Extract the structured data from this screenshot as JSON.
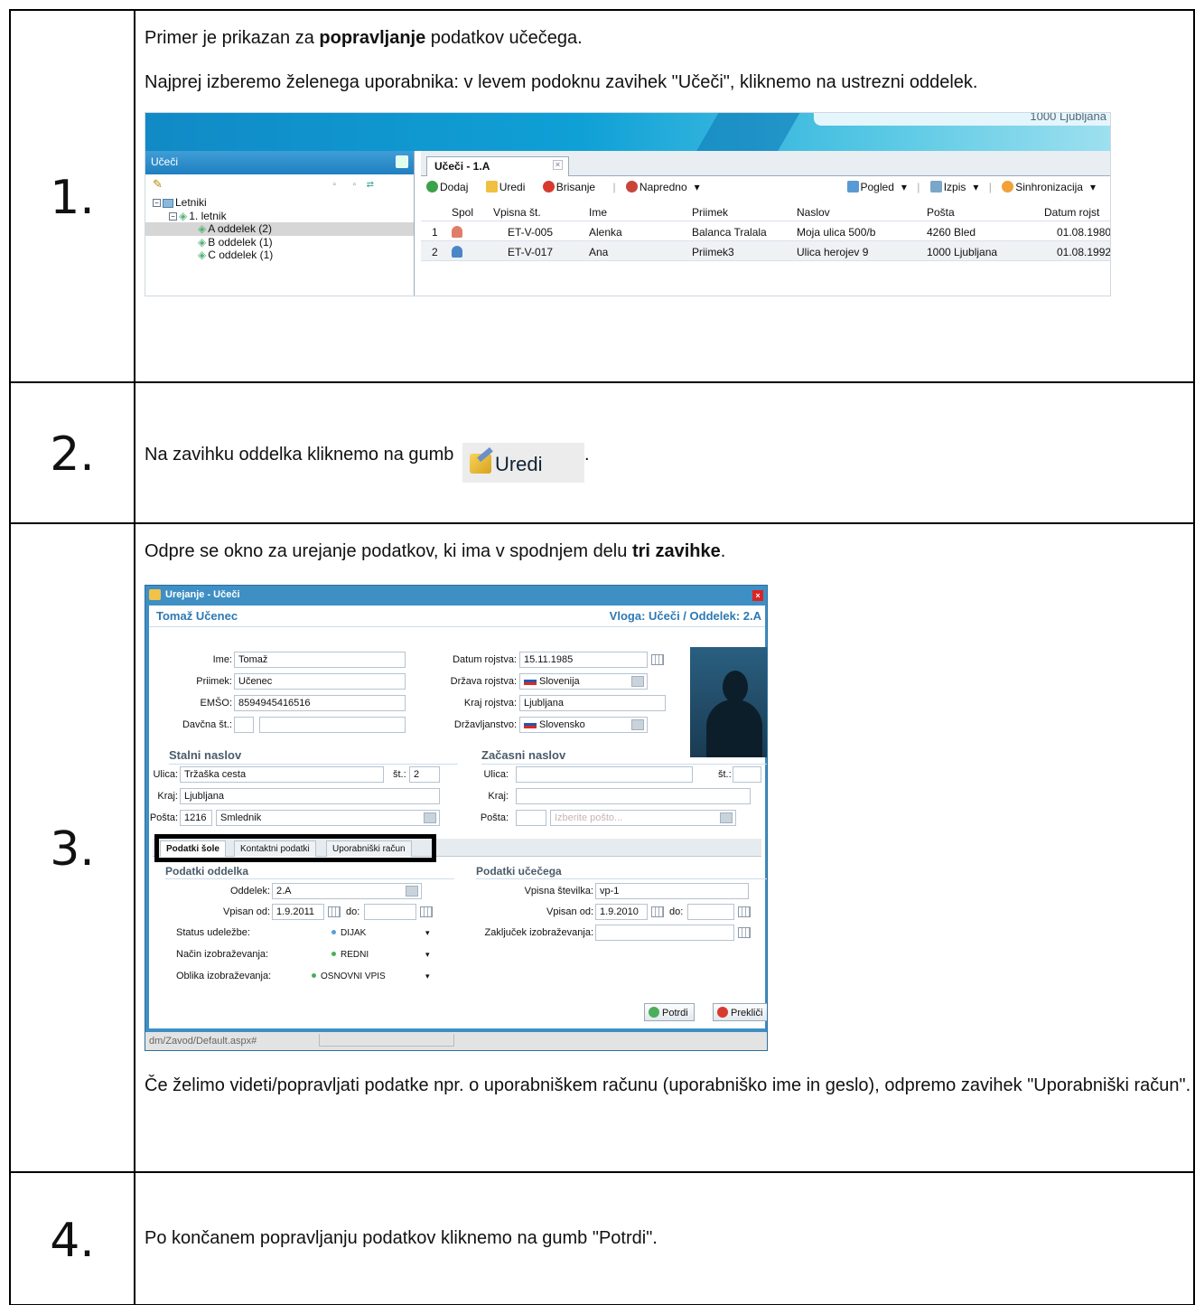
{
  "steps": [
    {
      "number": "1.",
      "text_pre": "Primer je prikazan za ",
      "text_bold": "popravljanje",
      "text_post": " podatkov učečega.",
      "text2": "Najprej izberemo želenega uporabnika: v levem podoknu zavihek \"Učeči\", kliknemo na ustrezni oddelek."
    },
    {
      "number": "2.",
      "text": "Na zavihku oddelka kliknemo na gumb ",
      "button_label": "Uredi",
      "text_end": "."
    },
    {
      "number": "3.",
      "text_pre": "Odpre se okno za urejanje podatkov, ki ima v spodnjem delu ",
      "text_bold": "tri zavihke",
      "text_post": ".",
      "text2": "Če želimo videti/popravljati podatke npr. o uporabniškem računu (uporabniško ime in geslo), odpremo zavihek \"Uporabniški račun\"."
    },
    {
      "number": "4.",
      "text": "Po končanem popravljanju podatkov kliknemo na gumb \"Potrdi\"."
    }
  ],
  "shot1": {
    "banner_address": "1000 Ljubljana",
    "left_title": "Učeči",
    "tree": [
      {
        "label": "Letniki"
      },
      {
        "label": "1. letnik"
      },
      {
        "label": "A oddelek (2)"
      },
      {
        "label": "B oddelek (1)"
      },
      {
        "label": "C oddelek (1)"
      }
    ],
    "tab_title": "Učeči - 1.A",
    "toolbar": {
      "dodaj": "Dodaj",
      "uredi": "Uredi",
      "brisanje": "Brisanje",
      "napredno": "Napredno",
      "pogled": "Pogled",
      "izpis": "Izpis",
      "sinhronizacija": "Sinhronizacija"
    },
    "columns": [
      "Spol",
      "Vpisna št.",
      "Ime",
      "Priimek",
      "Naslov",
      "Pošta",
      "Datum rojst"
    ],
    "rows": [
      {
        "n": "1",
        "vpisna": "ET-V-005",
        "ime": "Alenka",
        "priimek": "Balanca Tralala",
        "naslov": "Moja ulica 500/b",
        "posta": "4260 Bled",
        "datum": "01.08.1980"
      },
      {
        "n": "2",
        "vpisna": "ET-V-017",
        "ime": "Ana",
        "priimek": "Priimek3",
        "naslov": "Ulica herojev 9",
        "posta": "1000 Ljubljana",
        "datum": "01.08.1992"
      }
    ]
  },
  "dialog": {
    "title": "Urejanje - Učeči",
    "name": "Tomaž Učenec",
    "role": "Vloga: Učeči / Oddelek: 2.A",
    "fields": {
      "ime_label": "Ime:",
      "ime": "Tomaž",
      "priimek_label": "Priimek:",
      "priimek": "Učenec",
      "emso_label": "EMŠO:",
      "emso": "8594945416516",
      "davcna_label": "Davčna št.:",
      "datum_label": "Datum rojstva:",
      "datum": "15.11.1985",
      "drzava_label": "Država rojstva:",
      "drzava": "Slovenija",
      "kraj_rojstva_label": "Kraj rojstva:",
      "kraj_rojstva": "Ljubljana",
      "drzavljanstvo_label": "Državljanstvo:",
      "drzavljanstvo": "Slovensko"
    },
    "stalni": {
      "title": "Stalni naslov",
      "ulica_label": "Ulica:",
      "ulica": "Tržaška cesta",
      "st_label": "št.:",
      "st": "2",
      "kraj_label": "Kraj:",
      "kraj": "Ljubljana",
      "posta_label": "Pošta:",
      "posta_num": "1216",
      "posta_name": "Smlednik"
    },
    "zacasni": {
      "title": "Začasni naslov",
      "ulica_label": "Ulica:",
      "st_label": "št.:",
      "kraj_label": "Kraj:",
      "posta_label": "Pošta:",
      "posta_placeholder": "Izberite pošto..."
    },
    "tabs": [
      "Podatki šole",
      "Kontaktni podatki",
      "Uporabniški račun"
    ],
    "oddelek": {
      "title": "Podatki oddelka",
      "oddelek_label": "Oddelek:",
      "oddelek": "2.A",
      "vpisan_label": "Vpisan od:",
      "vpisan": "1.9.2011",
      "do_label": "do:",
      "status_label": "Status udeležbe:",
      "status": "DIJAK",
      "nacin_label": "Način izobraževanja:",
      "nacin": "REDNI",
      "oblika_label": "Oblika izobraževanja:",
      "oblika": "OSNOVNI VPIS"
    },
    "ucecega": {
      "title": "Podatki učečega",
      "vpisna_label": "Vpisna številka:",
      "vpisna": "vp-1",
      "vpisan_label": "Vpisan od:",
      "vpisan": "1.9.2010",
      "do_label": "do:",
      "zakljucek_label": "Zaključek izobraževanja:"
    },
    "confirm": "Potrdi",
    "cancel": "Prekliči",
    "statusbar": "dm/Zavod/Default.aspx#"
  },
  "colors": {
    "accent": "#2d79b4",
    "banner": "#118ac6",
    "highlight_border": "#000000"
  }
}
